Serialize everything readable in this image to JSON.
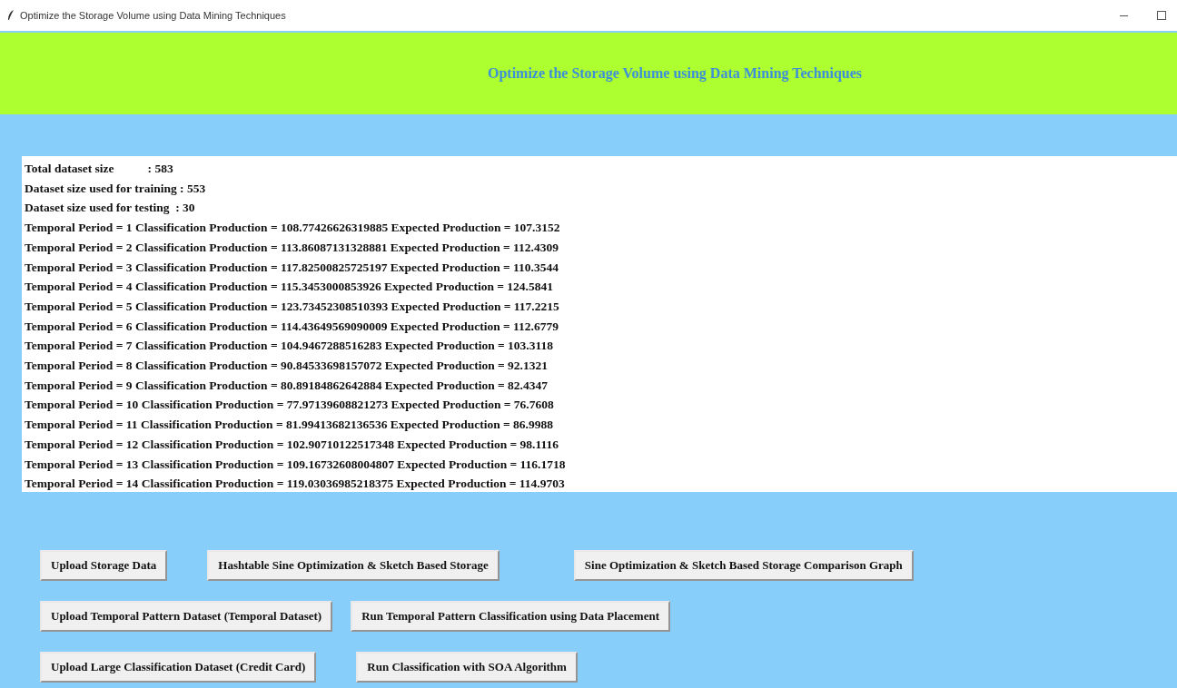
{
  "window": {
    "title": "Optimize the Storage Volume using Data Mining Techniques"
  },
  "header": {
    "title": "Optimize the Storage Volume using Data Mining Techniques"
  },
  "output_lines": [
    "Total dataset size           : 583",
    "Dataset size used for training : 553",
    "Dataset size used for testing  : 30",
    "Temporal Period = 1 Classification Production = 108.77426626319885 Expected Production = 107.3152",
    "Temporal Period = 2 Classification Production = 113.86087131328881 Expected Production = 112.4309",
    "Temporal Period = 3 Classification Production = 117.82500825725197 Expected Production = 110.3544",
    "Temporal Period = 4 Classification Production = 115.3453000853926 Expected Production = 124.5841",
    "Temporal Period = 5 Classification Production = 123.73452308510393 Expected Production = 117.2215",
    "Temporal Period = 6 Classification Production = 114.43649569090009 Expected Production = 112.6779",
    "Temporal Period = 7 Classification Production = 104.9467288516283 Expected Production = 103.3118",
    "Temporal Period = 8 Classification Production = 90.84533698157072 Expected Production = 92.1321",
    "Temporal Period = 9 Classification Production = 80.89184862642884 Expected Production = 82.4347",
    "Temporal Period = 10 Classification Production = 77.97139608821273 Expected Production = 76.7608",
    "Temporal Period = 11 Classification Production = 81.99413682136536 Expected Production = 86.9988",
    "Temporal Period = 12 Classification Production = 102.90710122517348 Expected Production = 98.1116",
    "Temporal Period = 13 Classification Production = 109.16732608004807 Expected Production = 116.1718",
    "Temporal Period = 14 Classification Production = 119.03036985218375 Expected Production = 114.9703"
  ],
  "button_rows": [
    [
      "Upload Storage Data",
      "Hashtable Sine Optimization & Sketch Based Storage",
      "Sine Optimization & Sketch Based Storage Comparison Graph"
    ],
    [
      "Upload Temporal Pattern Dataset (Temporal Dataset)",
      "Run Temporal Pattern Classification using Data Placement"
    ],
    [
      "Upload Large Classification Dataset (Credit Card)",
      "Run Classification with SOA Algorithm"
    ]
  ]
}
